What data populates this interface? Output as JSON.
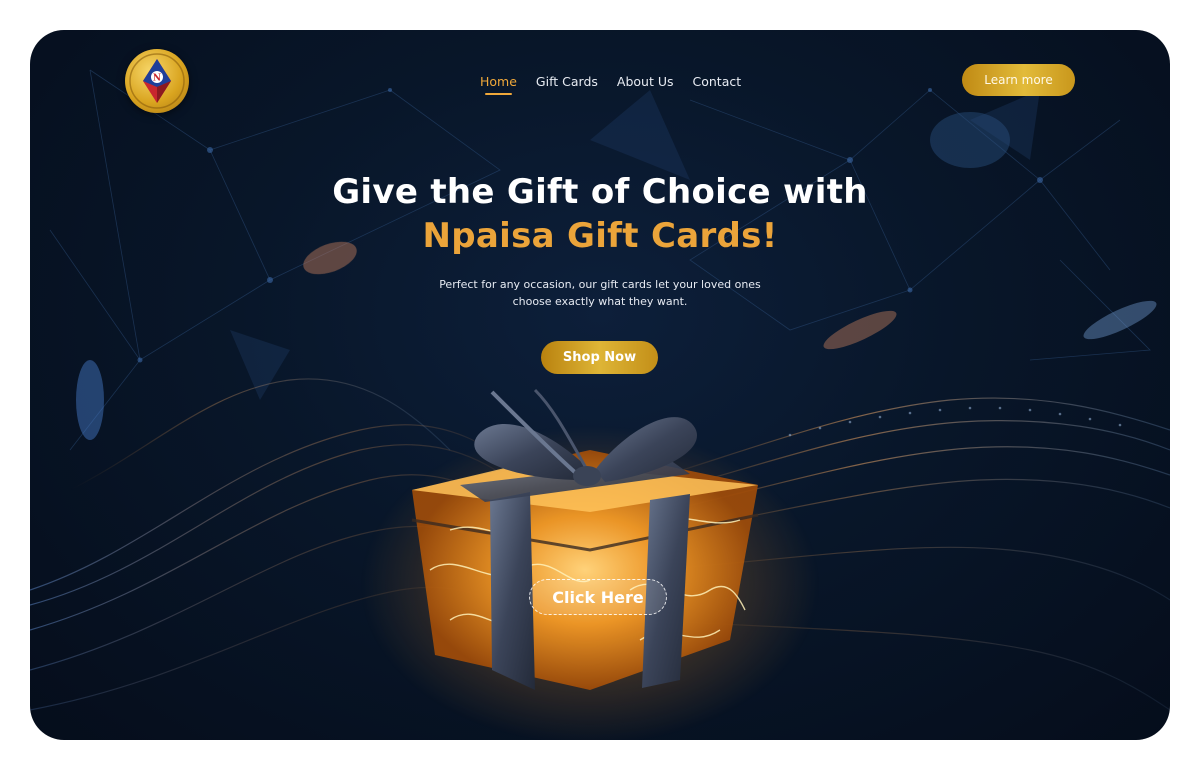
{
  "brand": {
    "logo_icon": "npaisa-coin-logo-icon",
    "logo_letter": "N",
    "colors": {
      "accent_gold": "#eba43a",
      "button_gold": "#deb536",
      "background_navy": "#081629"
    }
  },
  "nav": {
    "items": [
      {
        "label": "Home",
        "active": true
      },
      {
        "label": "Gift Cards",
        "active": false
      },
      {
        "label": "About Us",
        "active": false
      },
      {
        "label": "Contact",
        "active": false
      }
    ],
    "cta_label": "Learn more"
  },
  "hero": {
    "title_line1": "Give the Gift of Choice with",
    "title_line2": "Npaisa Gift Cards!",
    "subtitle": "Perfect for any occasion, our gift cards let your loved ones choose exactly what they want.",
    "primary_button": "Shop Now",
    "gift_button": "Click Here",
    "illustration_icon": "glowing-gift-box-icon"
  }
}
